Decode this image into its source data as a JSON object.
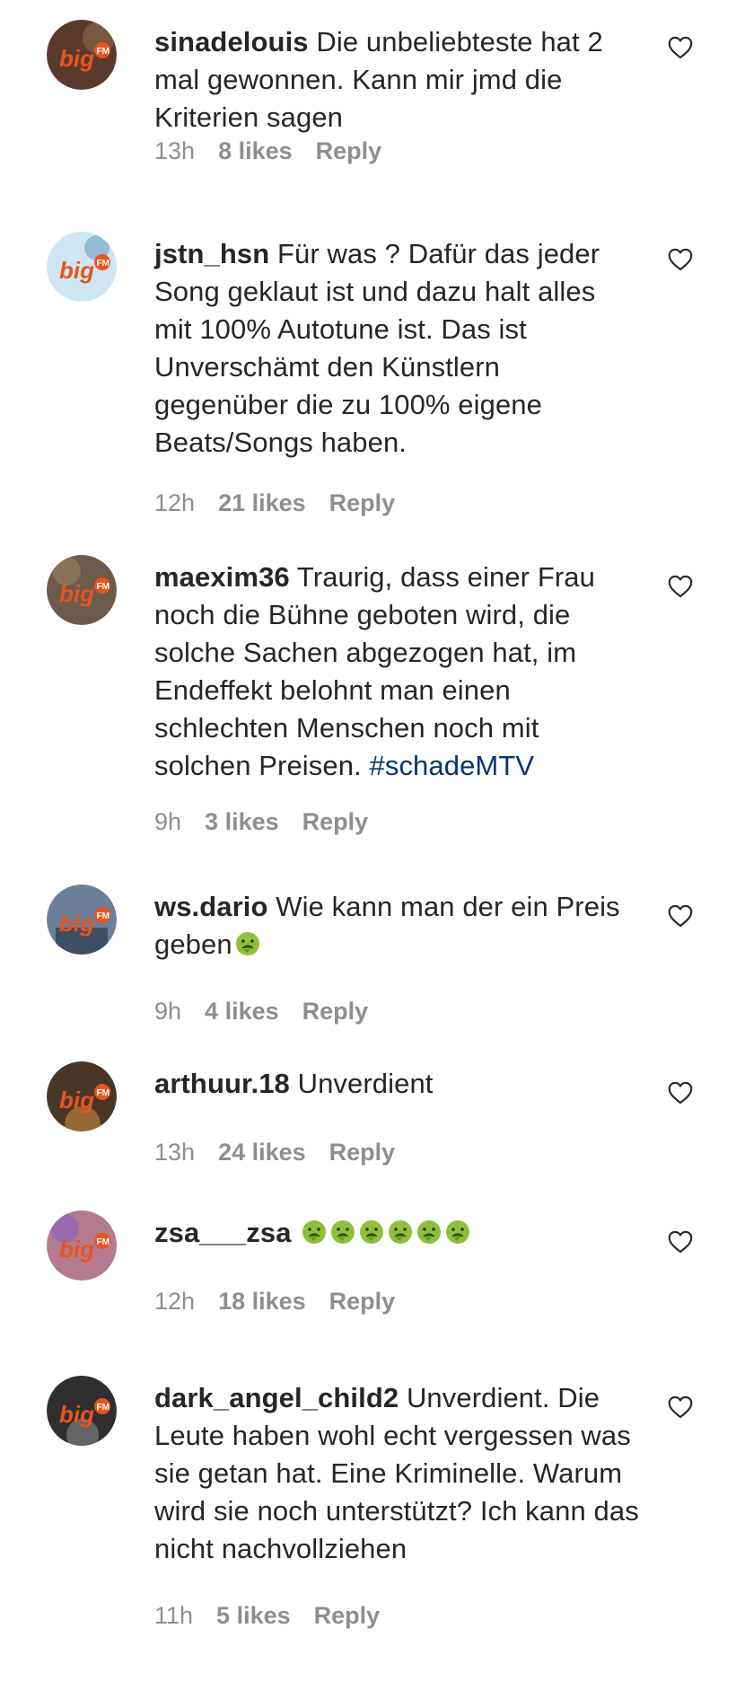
{
  "comments": [
    {
      "username": "sinadelouis",
      "text": "Die unbeliebteste hat 2 mal gewonnen. Kann mir jmd die Kriterien sagen",
      "time": "13h",
      "likes": "8 likes",
      "reply": "Reply",
      "avatar_label": "big",
      "avatar_bg": "#5a3a2c"
    },
    {
      "username": "jstn_hsn",
      "text": "Für was ? Dafür das jeder Song geklaut ist und dazu halt alles mit 100% Autotune ist. Das ist Unverschämt den Künstlern gegenüber die zu 100% eigene Beats/Songs haben.",
      "time": "12h",
      "likes": "21 likes",
      "reply": "Reply",
      "avatar_label": "big",
      "avatar_bg": "#cfe6f2"
    },
    {
      "username": "maexim36",
      "text": "Traurig, dass einer Frau noch die Bühne geboten wird, die solche Sachen abgezogen hat, im Endeffekt belohnt man einen schlechten Menschen noch mit solchen Preisen. ",
      "hashtag": "#schadeMTV",
      "time": "9h",
      "likes": "3 likes",
      "reply": "Reply",
      "avatar_label": "big",
      "avatar_bg": "#6e5a4a"
    },
    {
      "username": "ws.dario",
      "text": "Wie kann man der ein Preis geben",
      "emoji": "nauseated-face",
      "time": "9h",
      "likes": "4 likes",
      "reply": "Reply",
      "avatar_label": "big",
      "avatar_bg": "#6d7f96"
    },
    {
      "username": "arthuur.18",
      "text": "Unverdient",
      "time": "13h",
      "likes": "24 likes",
      "reply": "Reply",
      "avatar_label": "big",
      "avatar_bg": "#4a3626"
    },
    {
      "username": "zsa___zsa",
      "text": "",
      "emoji_count": 6,
      "emoji": "nauseated-face",
      "time": "12h",
      "likes": "18 likes",
      "reply": "Reply",
      "avatar_label": "big",
      "avatar_bg": "#b47a8e"
    },
    {
      "username": "dark_angel_child2",
      "text": "Unverdient. Die Leute haben wohl echt vergessen was sie getan hat. Eine Kriminelle. Warum wird sie noch unterstützt? Ich kann das nicht nachvollziehen",
      "time": "11h",
      "likes": "5 likes",
      "reply": "Reply",
      "avatar_label": "big",
      "avatar_bg": "#2f2f2f"
    }
  ],
  "colors": {
    "text": "#262626",
    "meta": "#8e8e8e",
    "hashtag": "#00376b",
    "logo": "#e8541e"
  },
  "icons": {
    "like": "heart-outline-icon",
    "emoji": "nauseated-face-emoji"
  }
}
